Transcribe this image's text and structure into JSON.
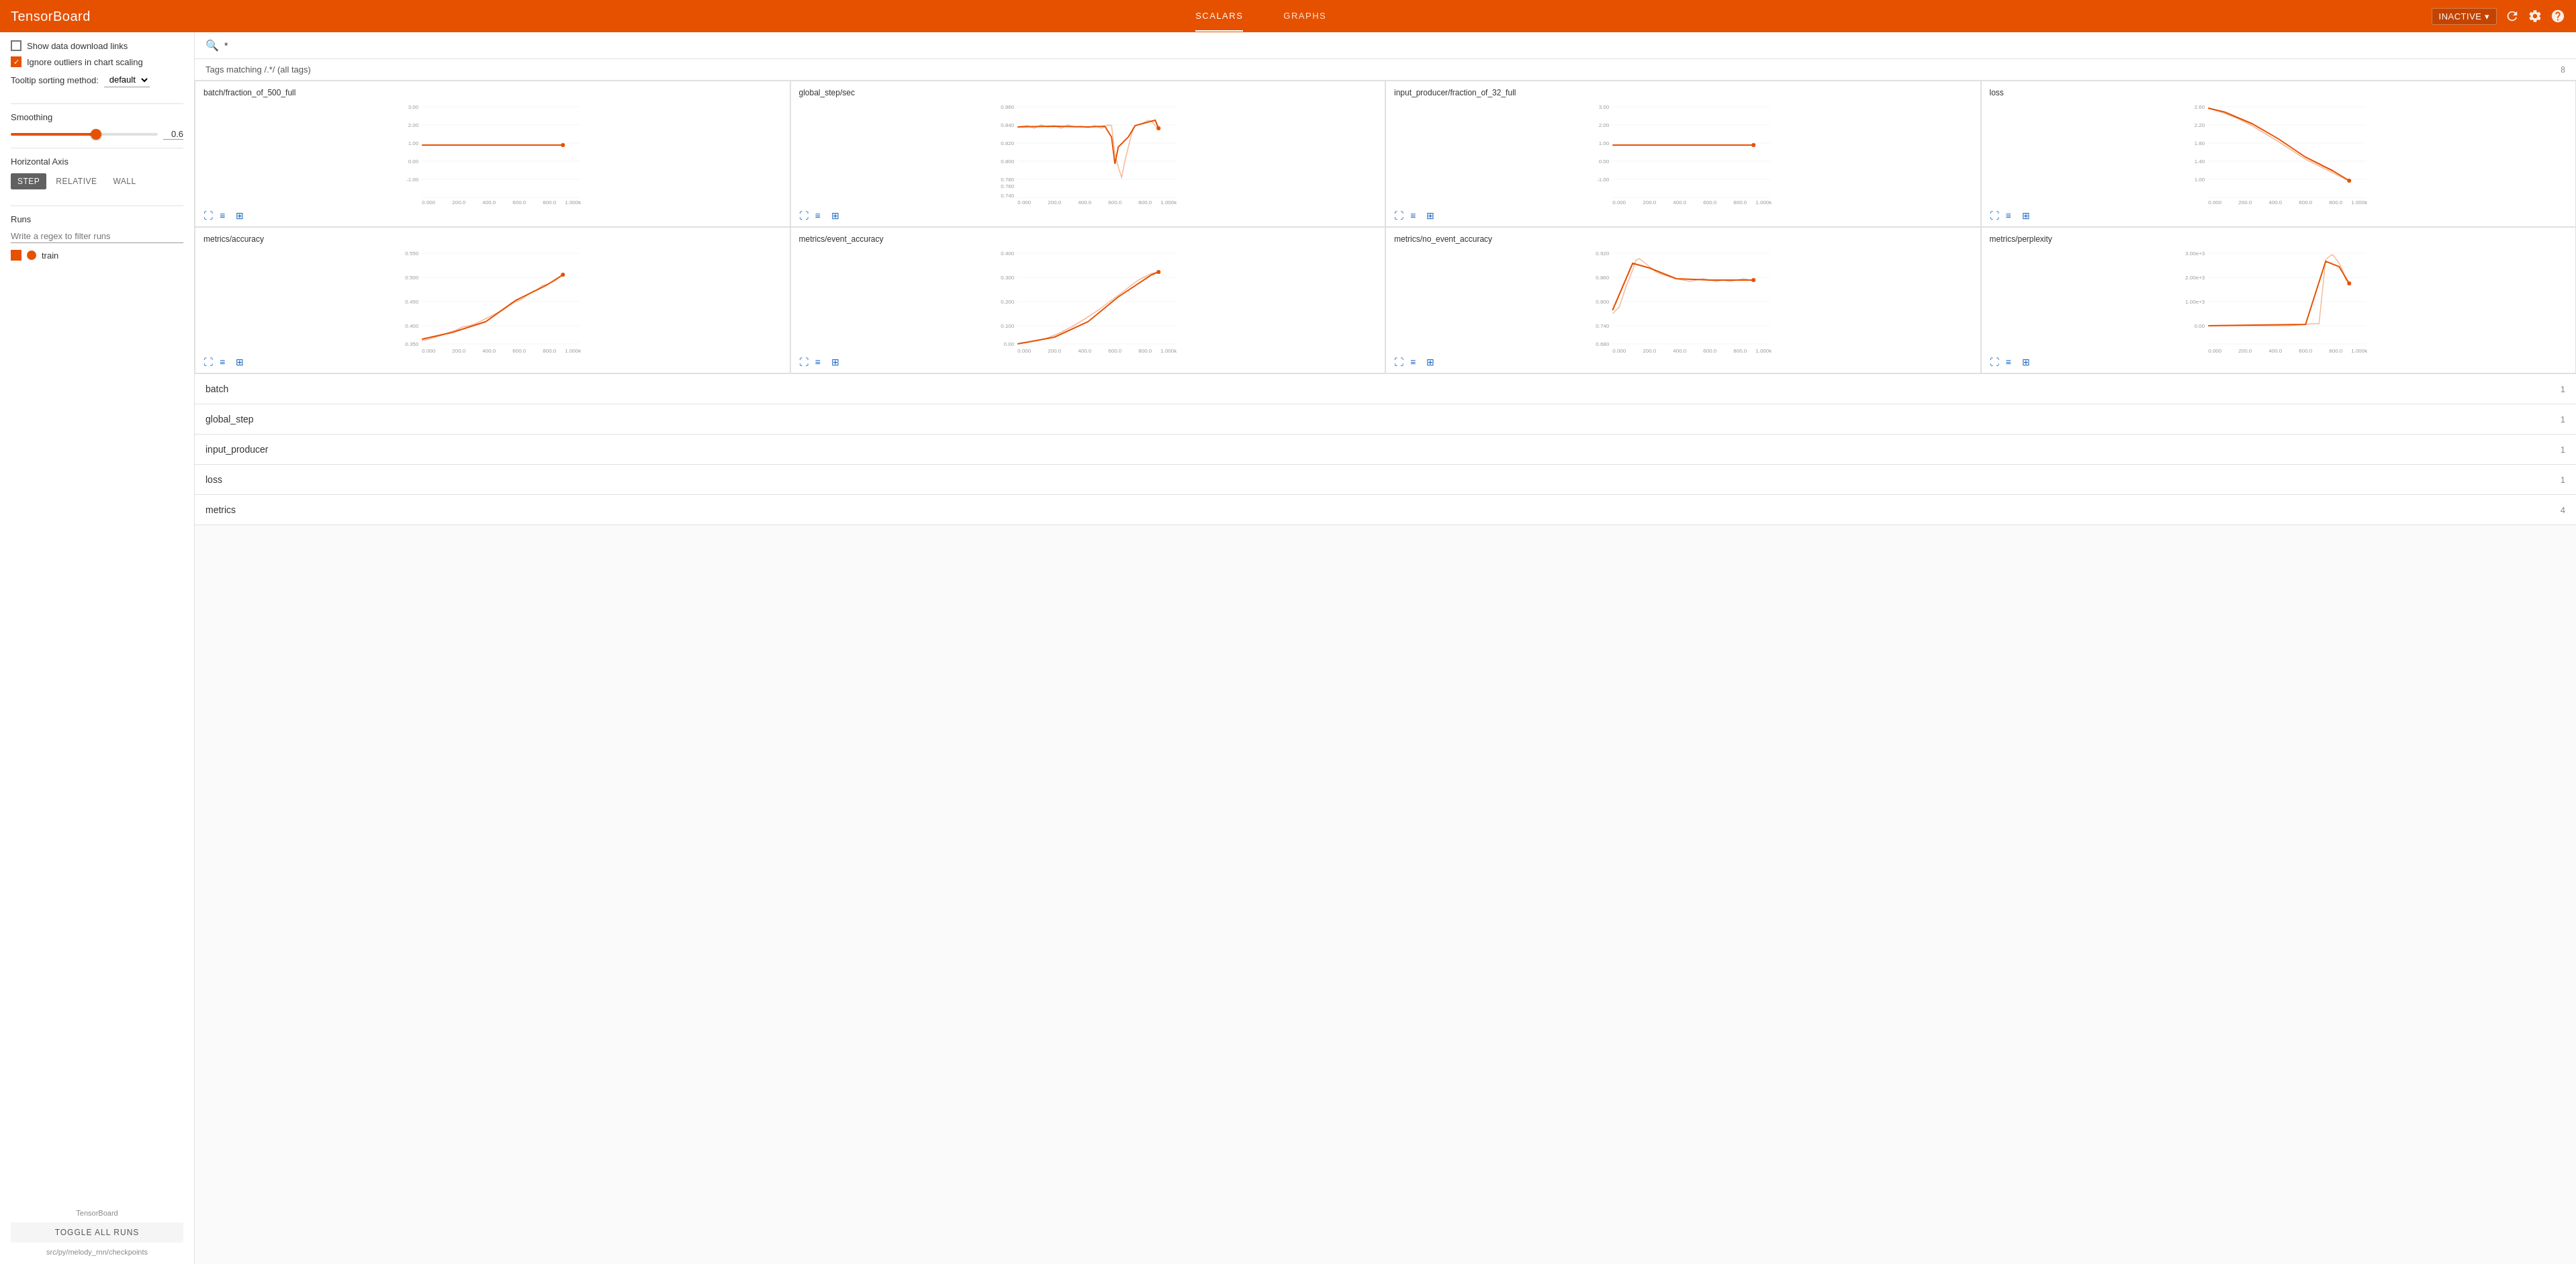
{
  "header": {
    "title": "TensorBoard",
    "nav": [
      {
        "label": "SCALARS",
        "active": true
      },
      {
        "label": "GRAPHS",
        "active": false
      }
    ],
    "status_label": "INACTIVE",
    "status_dropdown_icon": "▾"
  },
  "sidebar": {
    "show_download_links_label": "Show data download links",
    "ignore_outliers_label": "Ignore outliers in chart scaling",
    "ignore_outliers_checked": true,
    "tooltip_label": "Tooltip sorting method:",
    "tooltip_value": "default",
    "smoothing_label": "Smoothing",
    "smoothing_value": "0.6",
    "horizontal_axis_label": "Horizontal Axis",
    "axis_options": [
      "STEP",
      "RELATIVE",
      "WALL"
    ],
    "axis_active": "STEP",
    "runs_label": "Runs",
    "runs_filter_placeholder": "Write a regex to filter runs",
    "runs": [
      {
        "name": "train",
        "color": "#E65100",
        "active": true
      }
    ],
    "toggle_all_label": "TOGGLE ALL RUNS",
    "path": "src/py/melody_rnn/checkpoints",
    "tensorboard_label": "TensorBoard"
  },
  "content": {
    "search_value": "*",
    "tags_label": "Tags matching /.*/  (all tags)",
    "tags_count": "8",
    "charts": [
      {
        "title": "batch/fraction_of_500_full",
        "y_max": "3.00",
        "y_mid": "1.00",
        "y_zero": "0.00",
        "y_min": "-1.00",
        "x_labels": [
          "0.000",
          "200.0",
          "400.0",
          "600.0",
          "800.0",
          "1.000k"
        ],
        "type": "flat_line"
      },
      {
        "title": "global_step/sec",
        "y_max": "0.860",
        "y_vals": [
          "0.840",
          "0.820",
          "0.800",
          "0.780",
          "0.760",
          "0.740"
        ],
        "x_labels": [
          "0.000",
          "200.0",
          "400.0",
          "600.0",
          "800.0",
          "1.000k"
        ],
        "type": "wavy"
      },
      {
        "title": "input_producer/fraction_of_32_full",
        "y_max": "3.00",
        "y_mid": "1.00",
        "y_zero": "0.00",
        "y_min": "-1.00",
        "x_labels": [
          "0.000",
          "200.0",
          "400.0",
          "600.0",
          "800.0",
          "1.000k"
        ],
        "type": "flat_line"
      },
      {
        "title": "loss",
        "y_max": "2.60",
        "y_vals": [
          "2.20",
          "1.80",
          "1.40",
          "1.00"
        ],
        "x_labels": [
          "0.000",
          "200.0",
          "400.0",
          "600.0",
          "800.0",
          "1.000k"
        ],
        "type": "decay"
      },
      {
        "title": "metrics/accuracy",
        "y_max": "0.550",
        "y_vals": [
          "0.500",
          "0.450",
          "0.400",
          "0.350"
        ],
        "x_labels": [
          "0.000",
          "200.0",
          "400.0",
          "600.0",
          "800.0",
          "1.000k"
        ],
        "type": "rise"
      },
      {
        "title": "metrics/event_accuracy",
        "y_max": "0.400",
        "y_vals": [
          "0.300",
          "0.200",
          "0.100",
          "0.00"
        ],
        "x_labels": [
          "0.000",
          "200.0",
          "400.0",
          "600.0",
          "800.0",
          "1.000k"
        ],
        "type": "rise"
      },
      {
        "title": "metrics/no_event_accuracy",
        "y_max": "0.920",
        "y_vals": [
          "0.860",
          "0.800",
          "0.740",
          "0.680"
        ],
        "x_labels": [
          "0.000",
          "200.0",
          "400.0",
          "600.0",
          "800.0",
          "1.000k"
        ],
        "type": "bump"
      },
      {
        "title": "metrics/perplexity",
        "y_max": "3.00e+3",
        "y_vals": [
          "2.00e+3",
          "1.00e+3",
          "0.00"
        ],
        "x_labels": [
          "0.000",
          "200.0",
          "400.0",
          "600.0",
          "800.0",
          "1.000k"
        ],
        "type": "spike"
      }
    ],
    "sections": [
      {
        "name": "batch",
        "count": "1"
      },
      {
        "name": "global_step",
        "count": "1"
      },
      {
        "name": "input_producer",
        "count": "1"
      },
      {
        "name": "loss",
        "count": "1"
      },
      {
        "name": "metrics",
        "count": "4"
      }
    ]
  },
  "colors": {
    "orange": "#E65100",
    "blue": "#1565C0",
    "light_blue": "#1E88E5"
  }
}
